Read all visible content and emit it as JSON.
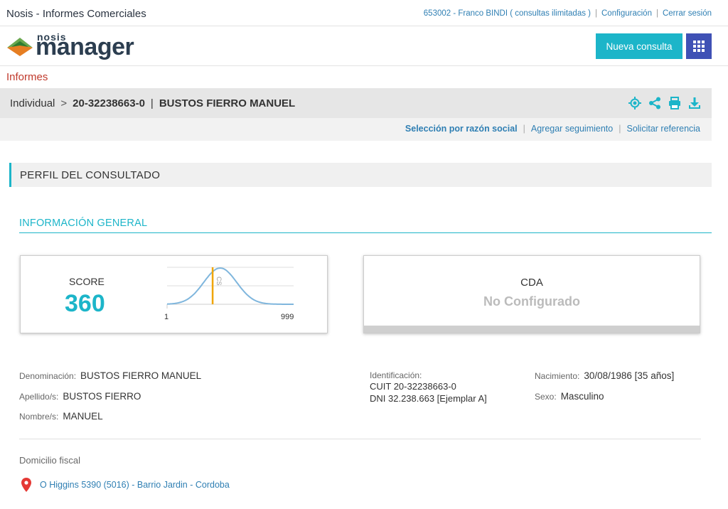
{
  "app": {
    "title": "Nosis - Informes Comerciales"
  },
  "top": {
    "user": "653002 - Franco BINDI ( consultas ilimitadas )",
    "config": "Configuración",
    "logout": "Cerrar sesión",
    "sep": "|"
  },
  "brand": {
    "line1": "nosis",
    "line2": "manager"
  },
  "header": {
    "new_query": "Nueva consulta"
  },
  "section": {
    "title": "Informes"
  },
  "breadcrumb": {
    "type": "Individual",
    "arrow": ">",
    "cuit": "20-32238663-0",
    "sep": "|",
    "name": "BUSTOS FIERRO MANUEL"
  },
  "actions": {
    "select": "Selección por razón social",
    "follow": "Agregar seguimiento",
    "request": "Solicitar referencia",
    "sep": "|"
  },
  "profile": {
    "title": "PERFIL DEL CONSULTADO"
  },
  "info": {
    "title": "INFORMACIÓN GENERAL"
  },
  "score": {
    "label": "SCORE",
    "value": "360",
    "min": "1",
    "max": "999",
    "score_fraction": 0.36,
    "marker_color": "#f0a500",
    "curve_color": "#7fb6dd"
  },
  "cda": {
    "title": "CDA",
    "status": "No Configurado"
  },
  "person": {
    "denominacion_label": "Denominación:",
    "denominacion": "BUSTOS FIERRO MANUEL",
    "apellido_label": "Apellido/s:",
    "apellido": "BUSTOS FIERRO",
    "nombre_label": "Nombre/s:",
    "nombre": "MANUEL",
    "id_label": "Identificación:",
    "cuit": "CUIT 20-32238663-0",
    "dni": "DNI 32.238.663 [Ejemplar A]",
    "nacimiento_label": "Nacimiento:",
    "nacimiento": "30/08/1986 [35 años]",
    "sexo_label": "Sexo:",
    "sexo": "Masculino"
  },
  "domicilio": {
    "label": "Domicilio fiscal",
    "address": "O Higgins 5390 (5016) - Barrio Jardin - Cordoba"
  },
  "colors": {
    "accent": "#1cb5c9",
    "indigo": "#3f51b5",
    "red": "#c0392b",
    "link": "#2f7fb3"
  }
}
